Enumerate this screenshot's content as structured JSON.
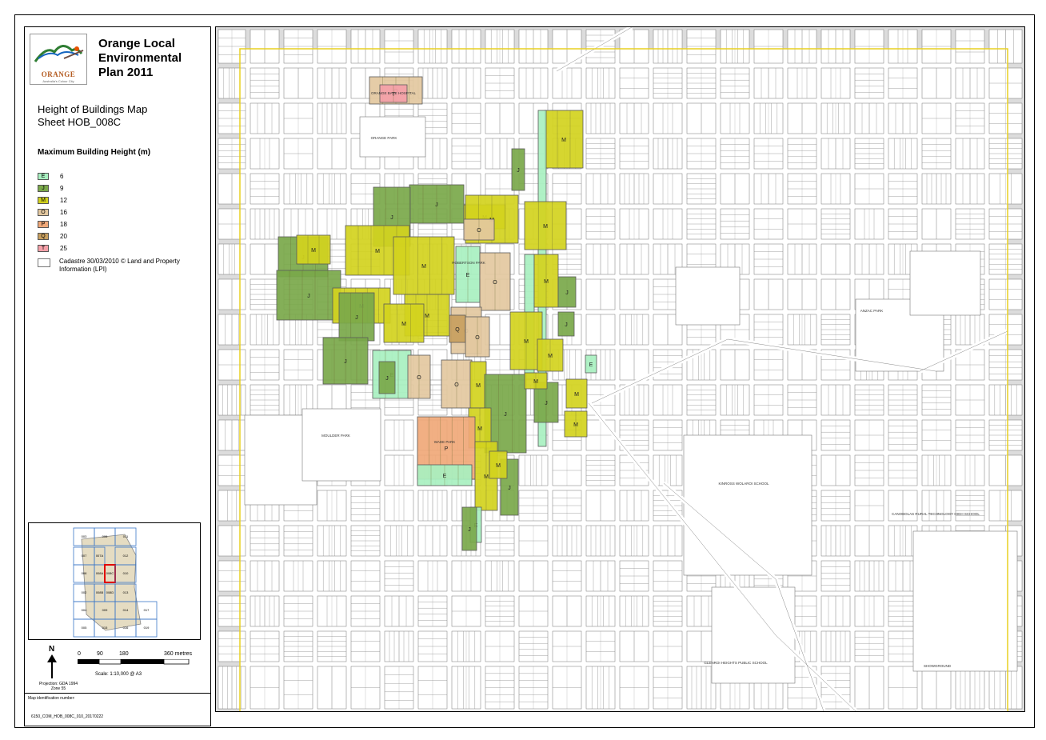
{
  "logo": {
    "text": "ORANGE",
    "subtext": "Australia's Colour City"
  },
  "plan_title": "Orange Local Environmental Plan 2011",
  "map_title": "Height of Buildings Map",
  "sheet": "Sheet HOB_008C",
  "legend": {
    "heading": "Maximum Building Height (m)",
    "items": [
      {
        "code": "E",
        "label": "6",
        "color": "#a8f0c0"
      },
      {
        "code": "J",
        "label": "9",
        "color": "#7aa84a"
      },
      {
        "code": "M",
        "label": "12",
        "color": "#d2d21e"
      },
      {
        "code": "O",
        "label": "16",
        "color": "#e3c8a0"
      },
      {
        "code": "P",
        "label": "18",
        "color": "#f0a878"
      },
      {
        "code": "Q",
        "label": "20",
        "color": "#c8a060"
      },
      {
        "code": "T",
        "label": "25",
        "color": "#f4a0a8"
      }
    ],
    "cadastre": "Cadastre 30/03/2010 © Land and Property Information (LPI)"
  },
  "index_map": {
    "tiles": [
      "003",
      "006",
      "011",
      "007",
      "007A",
      "012",
      "008",
      "008A",
      "008C",
      "010",
      "002",
      "008B",
      "008D",
      "013",
      "004",
      "009",
      "014",
      "017",
      "005",
      "015",
      "016",
      "019"
    ]
  },
  "scale": {
    "north": "N",
    "ticks": [
      "0",
      "90",
      "180",
      "360 metres"
    ],
    "ratio": "Scale: 1:10,000 @ A3",
    "projection": "Projection: GDA 1994 Zone 55"
  },
  "map_id": {
    "label": "Map identification number:",
    "value": "6150_COM_HOB_008C_010_20170222"
  },
  "map_labels": {
    "orange_park": "ORANGE PARK",
    "robertson_park": "ROBERTSON PARK",
    "wade_park": "WADE PARK",
    "moulder_park": "MOULDER PARK",
    "kinross_wolaroi": "KINROSS WOLAROI SCHOOL",
    "canobolas_school": "CANOBOLAS RURAL TECHNOLOGY HIGH SCHOOL",
    "anzac_park": "ANZAC PARK",
    "glenroi_heights": "GLENROI HEIGHTS PUBLIC SCHOOL",
    "showground": "SHOWGROUND",
    "hospital": "ORANGE BASE HOSPITAL"
  },
  "colors": {
    "zone_border": "#e8d020",
    "parcel_line": "#777777",
    "road": "#ffffff",
    "background": "#dcdcdc"
  }
}
